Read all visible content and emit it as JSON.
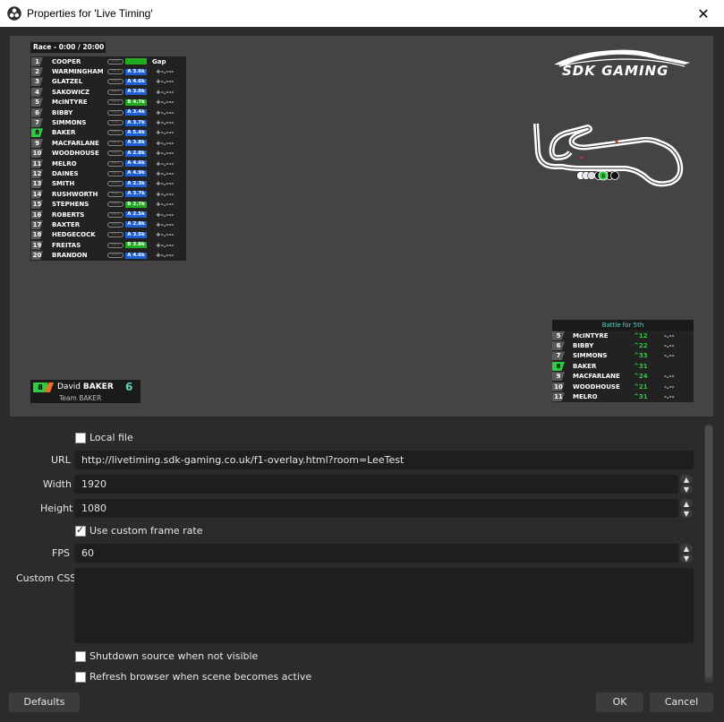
{
  "window": {
    "title": "Properties for 'Live Timing'",
    "close_glyph": "✕"
  },
  "preview": {
    "leaderboard": {
      "header": "Race - 0:00 / 20:00",
      "gap_header": "Gap",
      "rows": [
        {
          "pos": "1",
          "name": "COOPER",
          "badge": " ",
          "badge_color": "green",
          "gap": ""
        },
        {
          "pos": "2",
          "name": "WARMINGHAM",
          "badge": "A 3.6k",
          "badge_color": "blue",
          "gap": "+-.---"
        },
        {
          "pos": "3",
          "name": "GLATZEL",
          "badge": "A 4.6k",
          "badge_color": "blue",
          "gap": "+-.---"
        },
        {
          "pos": "4",
          "name": "SAKOWICZ",
          "badge": "A 3.0k",
          "badge_color": "blue",
          "gap": "+-.---"
        },
        {
          "pos": "5",
          "name": "McINTYRE",
          "badge": "B 4.7k",
          "badge_color": "green",
          "gap": "+-.---"
        },
        {
          "pos": "6",
          "name": "BIBBY",
          "badge": "A 3.4k",
          "badge_color": "blue",
          "gap": "+-.---"
        },
        {
          "pos": "7",
          "name": "SIMMONS",
          "badge": "A 3.7k",
          "badge_color": "blue",
          "gap": "+-.---"
        },
        {
          "pos": "8",
          "name": "BAKER",
          "badge": "A 5.4k",
          "badge_color": "blue",
          "gap": "+-.---",
          "highlight": true
        },
        {
          "pos": "9",
          "name": "MACFARLANE",
          "badge": "A 3.8k",
          "badge_color": "blue",
          "gap": "+-.---"
        },
        {
          "pos": "10",
          "name": "WOODHOUSE",
          "badge": "A 2.8k",
          "badge_color": "blue",
          "gap": "+-.---"
        },
        {
          "pos": "11",
          "name": "MELRO",
          "badge": "A 4.6k",
          "badge_color": "blue",
          "gap": "+-.---"
        },
        {
          "pos": "12",
          "name": "DAINES",
          "badge": "A 4.9k",
          "badge_color": "blue",
          "gap": "+-.---"
        },
        {
          "pos": "13",
          "name": "SMITH",
          "badge": "A 2.3k",
          "badge_color": "blue",
          "gap": "+-.---"
        },
        {
          "pos": "14",
          "name": "RUSHWORTH",
          "badge": "A 3.7k",
          "badge_color": "blue",
          "gap": "+-.---"
        },
        {
          "pos": "15",
          "name": "STEPHENS",
          "badge": "B 2.7k",
          "badge_color": "green",
          "gap": "+-.---"
        },
        {
          "pos": "16",
          "name": "ROBERTS",
          "badge": "A 2.5k",
          "badge_color": "blue",
          "gap": "+-.---"
        },
        {
          "pos": "17",
          "name": "BAXTER",
          "badge": "A 2.8k",
          "badge_color": "blue",
          "gap": "+-.---"
        },
        {
          "pos": "18",
          "name": "HEDGECOCK",
          "badge": "A 3.5k",
          "badge_color": "blue",
          "gap": "+-.---"
        },
        {
          "pos": "19",
          "name": "FREITAS",
          "badge": "B 3.8k",
          "badge_color": "green",
          "gap": "+-.---"
        },
        {
          "pos": "20",
          "name": "BRANDON",
          "badge": "A 4.6k",
          "badge_color": "blue",
          "gap": "+-.---"
        }
      ]
    },
    "logo_text": "SDK GAMING",
    "track_marker_label": "8",
    "driver_card": {
      "pos": "8",
      "first_name": "David",
      "last_name": "BAKER",
      "number": "6",
      "team": "Team BAKER"
    },
    "battle": {
      "header": "Battle for 5th",
      "rows": [
        {
          "pos": "5",
          "name": "McINTYRE",
          "val": "^12",
          "gap": "-.--"
        },
        {
          "pos": "6",
          "name": "BIBBY",
          "val": "^22",
          "gap": "-.--"
        },
        {
          "pos": "7",
          "name": "SIMMONS",
          "val": "^33",
          "gap": "-.--"
        },
        {
          "pos": "8",
          "name": "BAKER",
          "val": "^31",
          "gap": "",
          "highlight": true
        },
        {
          "pos": "9",
          "name": "MACFARLANE",
          "val": "^24",
          "gap": "-.--"
        },
        {
          "pos": "10",
          "name": "WOODHOUSE",
          "val": "^21",
          "gap": "-.--"
        },
        {
          "pos": "11",
          "name": "MELRO",
          "val": "^31",
          "gap": "-.--"
        }
      ]
    }
  },
  "form": {
    "local_file_label": "Local file",
    "local_file_checked": false,
    "url_label": "URL",
    "url_value": "http://livetiming.sdk-gaming.co.uk/f1-overlay.html?room=LeeTest",
    "width_label": "Width",
    "width_value": "1920",
    "height_label": "Height",
    "height_value": "1080",
    "custom_fps_label": "Use custom frame rate",
    "custom_fps_checked": true,
    "fps_label": "FPS",
    "fps_value": "60",
    "css_label": "Custom CSS",
    "shutdown_label": "Shutdown source when not visible",
    "shutdown_checked": false,
    "refresh_label": "Refresh browser when scene becomes active",
    "refresh_checked": false
  },
  "buttons": {
    "defaults": "Defaults",
    "ok": "OK",
    "cancel": "Cancel"
  }
}
